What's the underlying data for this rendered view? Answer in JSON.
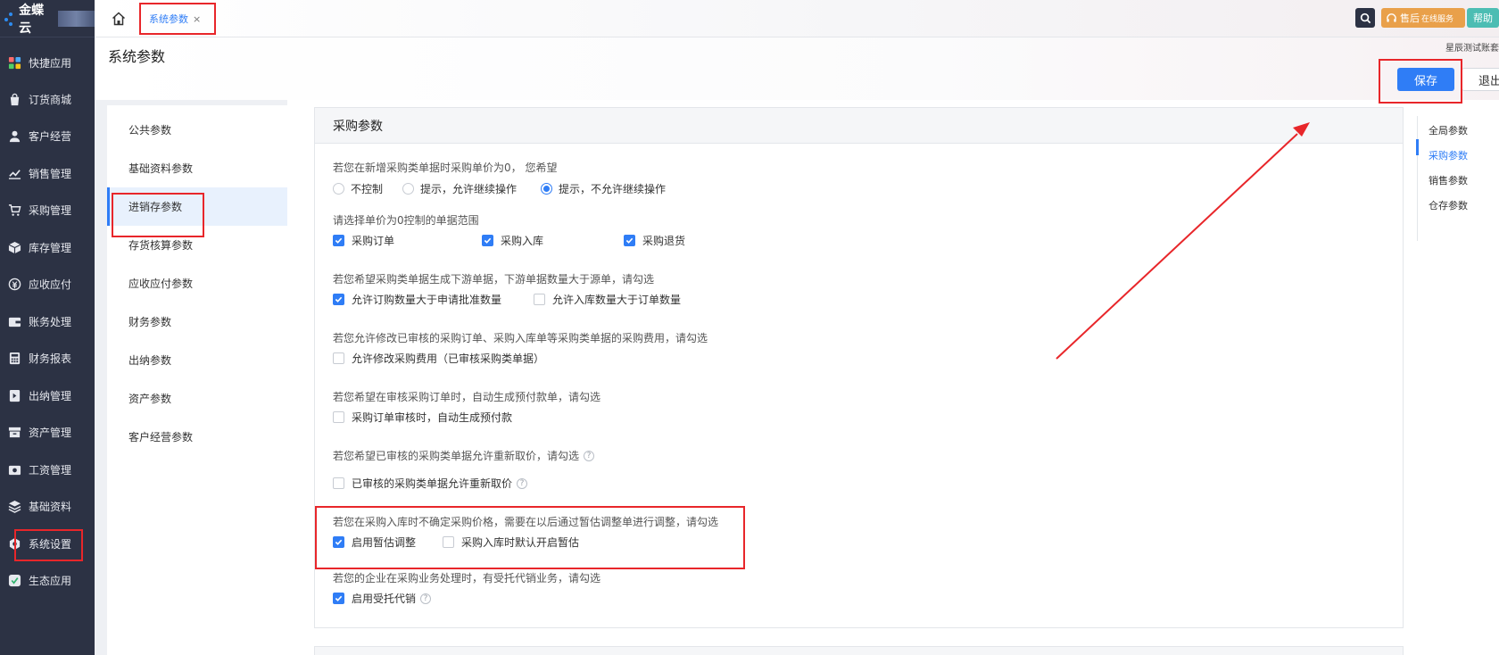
{
  "sidebar": {
    "brand": "金蝶云",
    "items": [
      {
        "label": "快捷应用",
        "icon": "grid-icon"
      },
      {
        "label": "订货商城",
        "icon": "shopping-bag-icon"
      },
      {
        "label": "客户经营",
        "icon": "user-icon"
      },
      {
        "label": "销售管理",
        "icon": "trend-chart-icon"
      },
      {
        "label": "采购管理",
        "icon": "cart-icon"
      },
      {
        "label": "库存管理",
        "icon": "box-icon"
      },
      {
        "label": "应收应付",
        "icon": "coin-icon"
      },
      {
        "label": "账务处理",
        "icon": "wallet-icon"
      },
      {
        "label": "财务报表",
        "icon": "calculator-icon"
      },
      {
        "label": "出纳管理",
        "icon": "cashier-icon"
      },
      {
        "label": "资产管理",
        "icon": "asset-icon"
      },
      {
        "label": "工资管理",
        "icon": "salary-icon"
      },
      {
        "label": "基础资料",
        "icon": "layers-icon"
      },
      {
        "label": "系统设置",
        "icon": "settings-icon"
      },
      {
        "label": "生态应用",
        "icon": "ecosystem-icon"
      }
    ]
  },
  "topbar": {
    "tab_label": "系统参数",
    "tab_close": "×",
    "after_sale_label": "售后",
    "after_sale_sub": "在线服务",
    "help_label": "帮助"
  },
  "header": {
    "title": "系统参数",
    "account_name": "星辰测试账套",
    "save_label": "保存",
    "exit_label": "退出"
  },
  "categories": [
    "公共参数",
    "基础资料参数",
    "进销存参数",
    "存货核算参数",
    "应收应付参数",
    "财务参数",
    "出纳参数",
    "资产参数",
    "客户经营参数"
  ],
  "panel": {
    "title": "采购参数",
    "sections": [
      {
        "question": "若您在新增采购类单据时采购单价为0， 您希望",
        "type": "radio",
        "options": [
          {
            "label": "不控制",
            "checked": false
          },
          {
            "label": "提示，允许继续操作",
            "checked": false
          },
          {
            "label": "提示，不允许继续操作",
            "checked": true
          }
        ]
      },
      {
        "question": "请选择单价为0控制的单据范围",
        "type": "checkbox",
        "options": [
          {
            "label": "采购订单",
            "checked": true
          },
          {
            "label": "采购入库",
            "checked": true
          },
          {
            "label": "采购退货",
            "checked": true
          }
        ]
      },
      {
        "question": "若您希望采购类单据生成下游单据，下游单据数量大于源单，请勾选",
        "type": "checkbox",
        "options": [
          {
            "label": "允许订购数量大于申请批准数量",
            "checked": true
          },
          {
            "label": "允许入库数量大于订单数量",
            "checked": false
          }
        ]
      },
      {
        "question": "若您允许修改已审核的采购订单、采购入库单等采购类单据的采购费用，请勾选",
        "type": "checkbox",
        "options": [
          {
            "label": "允许修改采购费用（已审核采购类单据）",
            "checked": false
          }
        ]
      },
      {
        "question": "若您希望在审核采购订单时，自动生成预付款单，请勾选",
        "type": "checkbox",
        "options": [
          {
            "label": "采购订单审核时，自动生成预付款",
            "checked": false
          }
        ]
      },
      {
        "question": "若您希望已审核的采购类单据允许重新取价，请勾选",
        "type": "checkbox",
        "options": [
          {
            "label": "已审核的采购类单据允许重新取价",
            "checked": false
          }
        ]
      },
      {
        "question": "若您在采购入库时不确定采购价格，需要在以后通过暂估调整单进行调整，请勾选",
        "type": "checkbox",
        "options": [
          {
            "label": "启用暂估调整",
            "checked": true
          },
          {
            "label": "采购入库时默认开启暂估",
            "checked": false
          }
        ]
      },
      {
        "question": "若您的企业在采购业务处理时，有受托代销业务，请勾选",
        "type": "checkbox",
        "options": [
          {
            "label": "启用受托代销",
            "checked": true
          }
        ]
      }
    ]
  },
  "anchors": [
    {
      "label": "全局参数",
      "active": false
    },
    {
      "label": "采购参数",
      "active": true
    },
    {
      "label": "销售参数",
      "active": false
    },
    {
      "label": "仓存参数",
      "active": false
    }
  ],
  "help_glyph": "?",
  "colors": {
    "accent": "#2f7df6",
    "sidebar_bg": "#2c3244",
    "annotation": "#e8262a",
    "after_sale": "#e9a04a",
    "help": "#4cbdb3"
  }
}
